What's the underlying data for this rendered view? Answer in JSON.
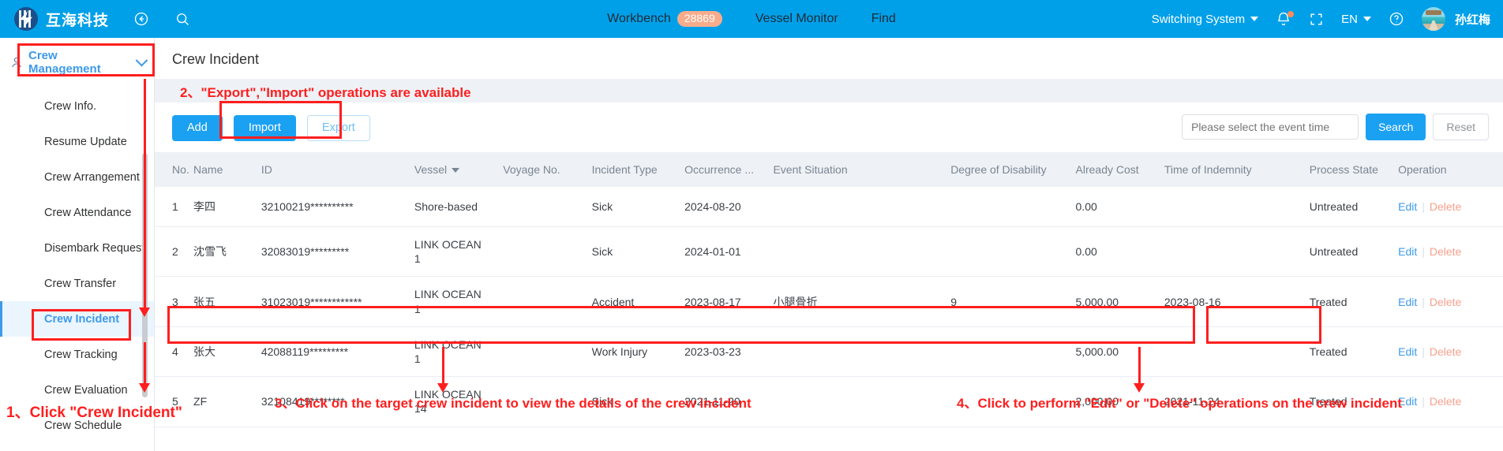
{
  "header": {
    "brand_name": "互海科技",
    "back_icon": "back-arrow-icon",
    "search_icon": "search-icon",
    "nav": [
      {
        "label": "Workbench",
        "badge": "28869"
      },
      {
        "label": "Vessel Monitor",
        "badge": ""
      },
      {
        "label": "Find",
        "badge": ""
      }
    ],
    "switching_system": "Switching System",
    "language": "EN",
    "username": "孙红梅"
  },
  "sidebar": {
    "group_title": "Crew Management",
    "items": [
      {
        "label": "Crew Info."
      },
      {
        "label": "Resume Update"
      },
      {
        "label": "Crew Arrangement"
      },
      {
        "label": "Crew Attendance"
      },
      {
        "label": "Disembark Request"
      },
      {
        "label": "Crew Transfer"
      },
      {
        "label": "Crew Incident"
      },
      {
        "label": "Crew Tracking"
      },
      {
        "label": "Crew Evaluation"
      },
      {
        "label": "Crew Schedule"
      }
    ],
    "active_index": 6
  },
  "main": {
    "page_title": "Crew Incident",
    "toolbar": {
      "add_label": "Add",
      "import_label": "Import",
      "export_label": "Export"
    },
    "search": {
      "date_placeholder": "Please select the event time",
      "search_label": "Search",
      "reset_label": "Reset"
    },
    "table": {
      "columns": [
        "No.",
        "Name",
        "ID",
        "Vessel",
        "Voyage No.",
        "Incident Type",
        "Occurrence ...",
        "Event Situation",
        "Degree of Disability",
        "Already Cost",
        "Time of Indemnity",
        "Process State",
        "Operation"
      ],
      "vessel_sortable": true,
      "operation_labels": {
        "edit": "Edit",
        "delete": "Delete"
      },
      "rows": [
        {
          "no": "1",
          "name": "李四",
          "id": "32100219**********",
          "vessel": "Shore-based",
          "voyage": "",
          "incident_type": "Sick",
          "occurrence": "2024-08-20",
          "event_situation": "",
          "disability": "",
          "cost": "0.00",
          "indemnity_time": "",
          "state": "Untreated",
          "state_kind": "untreated"
        },
        {
          "no": "2",
          "name": "沈雪飞",
          "id": "32083019*********",
          "vessel": "LINK OCEAN\n1",
          "voyage": "",
          "incident_type": "Sick",
          "occurrence": "2024-01-01",
          "event_situation": "",
          "disability": "",
          "cost": "0.00",
          "indemnity_time": "",
          "state": "Untreated",
          "state_kind": "untreated"
        },
        {
          "no": "3",
          "name": "张五",
          "id": "31023019************",
          "vessel": "LINK OCEAN\n1",
          "voyage": "",
          "incident_type": "Accident",
          "occurrence": "2023-08-17",
          "event_situation": "小腿骨折",
          "disability": "9",
          "cost": "5,000.00",
          "indemnity_time": "2023-08-16",
          "state": "Treated",
          "state_kind": "treated"
        },
        {
          "no": "4",
          "name": "张大",
          "id": "42088119*********",
          "vessel": "LINK OCEAN\n1",
          "voyage": "",
          "incident_type": "Work Injury",
          "occurrence": "2023-03-23",
          "event_situation": "",
          "disability": "",
          "cost": "5,000.00",
          "indemnity_time": "",
          "state": "Treated",
          "state_kind": "treated"
        },
        {
          "no": "5",
          "name": "ZF",
          "id": "32108419********",
          "vessel": "LINK OCEAN\n14",
          "voyage": "",
          "incident_type": "Sick",
          "occurrence": "2021-11-20",
          "event_situation": "",
          "disability": "",
          "cost": "2,000.00",
          "indemnity_time": "2021-11-24",
          "state": "Treated",
          "state_kind": "treated"
        }
      ]
    }
  },
  "annotations": {
    "step1": "1、Click \"Crew Incident\"",
    "step2": "2、\"Export\",\"Import\" operations are available",
    "step3": "3、Click on the target crew incident to view the details of the crew incident",
    "step4": "4、Click to perform \"Edit\" or \"Delete\" operations on the crew incident",
    "color": "#FF1E1E"
  }
}
